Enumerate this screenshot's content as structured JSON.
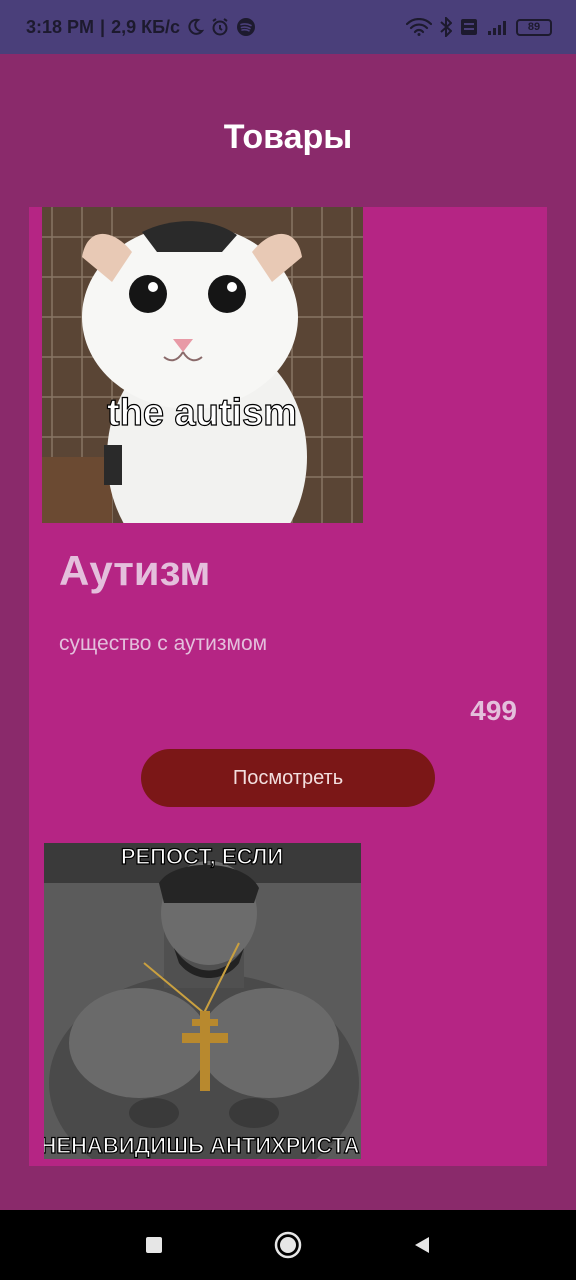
{
  "status_bar": {
    "time": "3:18 PM",
    "network_speed": "2,9 КБ/с",
    "battery_level": "89",
    "icons": [
      "moon-icon",
      "alarm-icon",
      "spotify-icon",
      "wifi-icon",
      "bluetooth-icon",
      "volte-icon",
      "signal-icon",
      "battery-icon"
    ]
  },
  "header": {
    "title": "Товары"
  },
  "products": [
    {
      "image_caption": "the autism",
      "name": "Аутизм",
      "description": "существо с аутизмом",
      "price": "499",
      "button_label": "Посмотреть"
    },
    {
      "image_caption_top": "РЕПОСТ, ЕСЛИ",
      "image_caption_bottom": "НЕНАВИДИШЬ АНТИХРИСТА"
    }
  ],
  "nav_bar": {
    "icons": [
      "recents-icon",
      "home-icon",
      "back-icon"
    ]
  },
  "colors": {
    "status_bar": "#4a3f7a",
    "app_background": "#8a2a6b",
    "card_background": "#b52584",
    "button_background": "#7b1717",
    "text_light": "#e4bfdc"
  }
}
